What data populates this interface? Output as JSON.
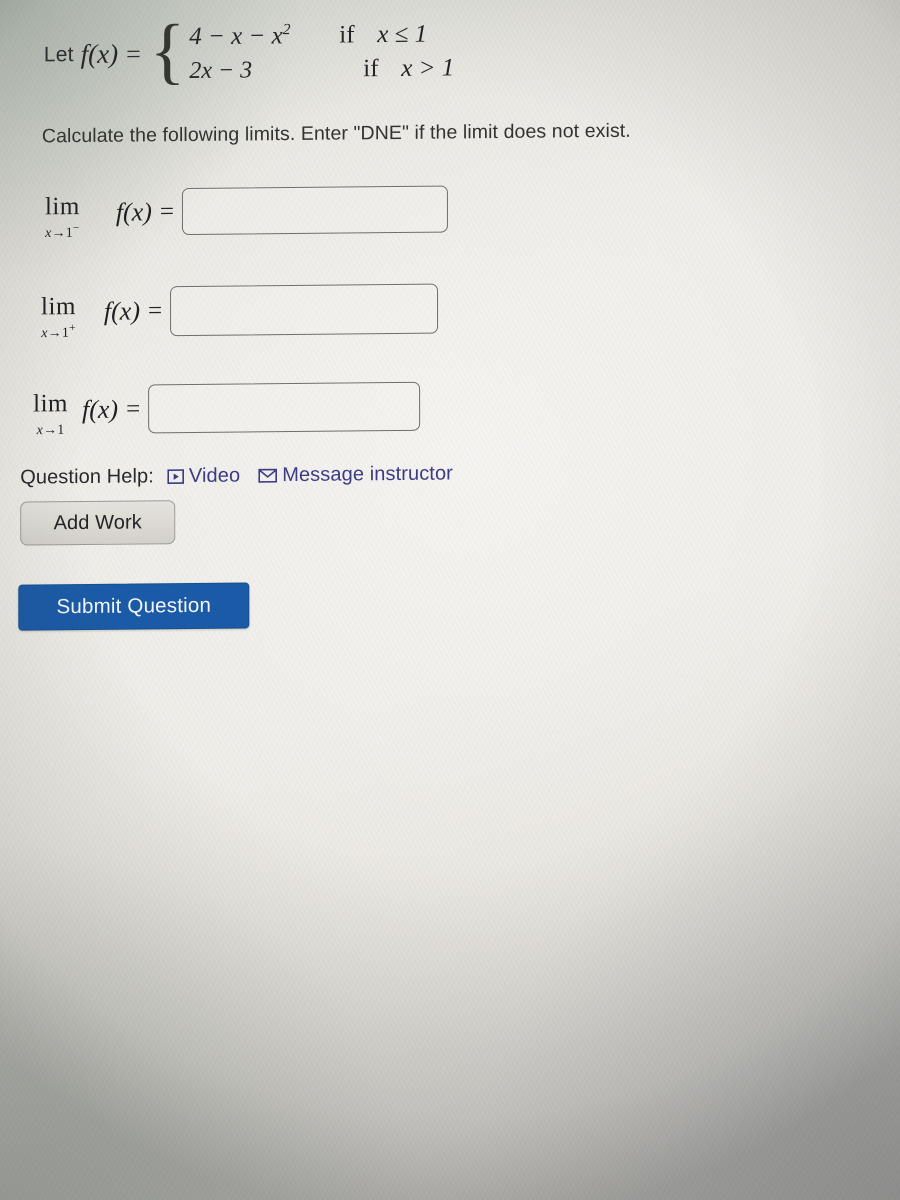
{
  "problem": {
    "let_label": "Let",
    "function_name": "f(x)",
    "equals": "=",
    "brace": "{",
    "cases": [
      {
        "expression_base": "4 − x − x",
        "expression_sup": "2",
        "if_word": "if",
        "condition": "x ≤ 1"
      },
      {
        "expression_base": "2x − 3",
        "expression_sup": "",
        "if_word": "if",
        "condition": "x > 1"
      }
    ]
  },
  "instructions": "Calculate the following limits. Enter \"DNE\" if the limit does not exist.",
  "limits": [
    {
      "lim_word": "lim",
      "sub_var": "x",
      "sub_arrow": "→",
      "sub_target": "1",
      "sub_side": "−",
      "function": "f(x)",
      "equals": "=",
      "answer_value": "",
      "answer_placeholder": ""
    },
    {
      "lim_word": "lim",
      "sub_var": "x",
      "sub_arrow": "→",
      "sub_target": "1",
      "sub_side": "+",
      "function": "f(x)",
      "equals": "=",
      "answer_value": "",
      "answer_placeholder": ""
    },
    {
      "lim_word": "lim",
      "sub_var": "x",
      "sub_arrow": "→",
      "sub_target": "1",
      "sub_side": "",
      "function": "f(x)",
      "equals": "=",
      "answer_value": "",
      "answer_placeholder": ""
    }
  ],
  "question_help": {
    "label": "Question Help:",
    "video_label": "Video",
    "video_icon": "play-in-box-icon",
    "message_label": "Message instructor",
    "message_icon": "envelope-icon",
    "link_color": "#3b3b85"
  },
  "buttons": {
    "add_work": "Add Work",
    "submit_question": "Submit Question",
    "submit_color": "#1b5aa6"
  }
}
